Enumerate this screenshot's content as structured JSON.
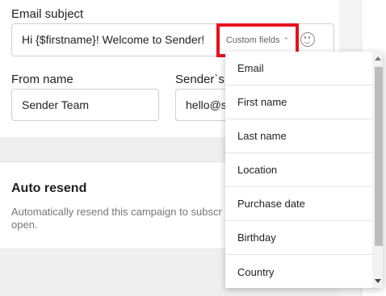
{
  "email_subject": {
    "label": "Email subject",
    "value": "Hi {$firstname}! Welcome to Sender!",
    "custom_fields_label": "Custom fields",
    "custom_fields_icon": "chevron-up-icon",
    "emoji_icon": "smiley-icon",
    "highlight_color": "#e8101d"
  },
  "from_name": {
    "label": "From name",
    "value": "Sender Team"
  },
  "sender_email": {
    "label": "Sender`s e",
    "value": "hello@se"
  },
  "auto_resend": {
    "title": "Auto resend",
    "description": "Automatically resend this campaign to subscr open."
  },
  "dropdown": {
    "items": [
      "Email",
      "First name",
      "Last name",
      "Location",
      "Purchase date",
      "Birthday",
      "Country"
    ]
  }
}
